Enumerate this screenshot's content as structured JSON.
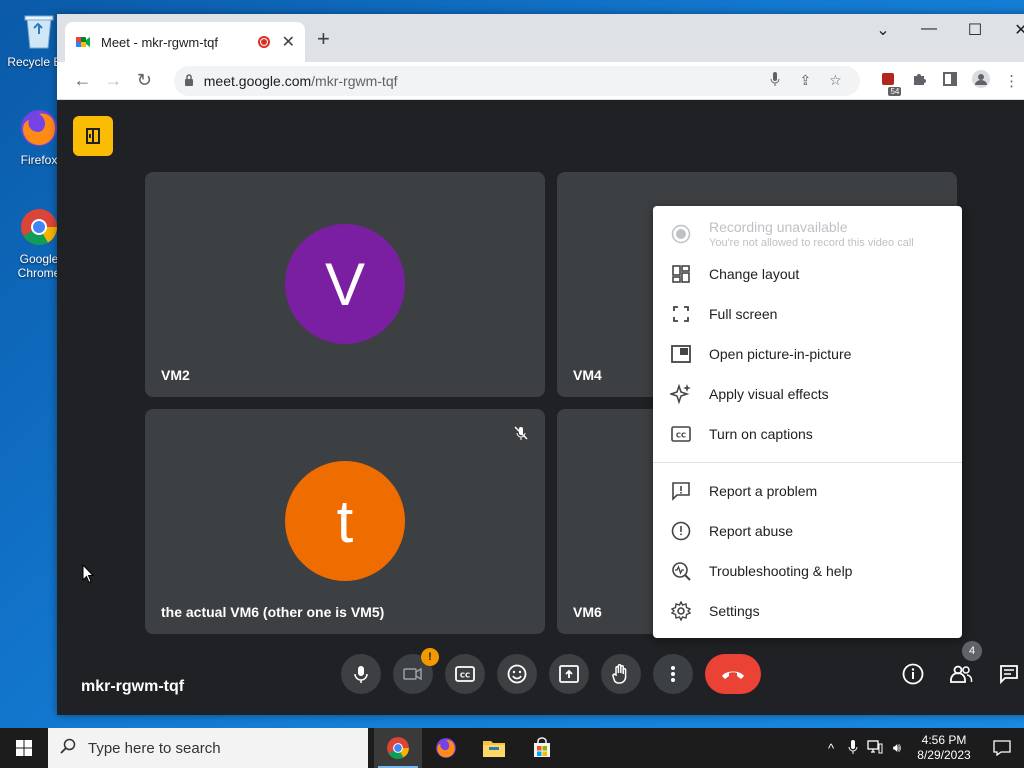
{
  "desktop": {
    "icons": [
      {
        "label": "Recycle Bin"
      },
      {
        "label": "Firefox"
      },
      {
        "label": "Google Chrome"
      }
    ]
  },
  "browser": {
    "tab_title": "Meet - mkr-rgwm-tqf",
    "new_tab_label": "+",
    "url_host": "meet.google.com",
    "url_path": "/mkr-rgwm-tqf",
    "extension_badge": "54"
  },
  "meet": {
    "meeting_code": "mkr-rgwm-tqf",
    "participant_count": "4",
    "tiles": [
      {
        "name": "VM2",
        "initial": "V",
        "avatar_color": "#7b1fa2"
      },
      {
        "name": "VM4",
        "initial": "",
        "avatar_color": ""
      },
      {
        "name": "the actual VM6 (other one is VM5)",
        "initial": "t",
        "avatar_color": "#ef6c00"
      },
      {
        "name": "VM6",
        "initial": "",
        "avatar_color": ""
      }
    ],
    "camera_warning": "!"
  },
  "menu": {
    "recording_title": "Recording unavailable",
    "recording_sub": "You're not allowed to record this video call",
    "items": [
      {
        "label": "Change layout"
      },
      {
        "label": "Full screen"
      },
      {
        "label": "Open picture-in-picture"
      },
      {
        "label": "Apply visual effects"
      },
      {
        "label": "Turn on captions"
      },
      {
        "label": "Report a problem"
      },
      {
        "label": "Report abuse"
      },
      {
        "label": "Troubleshooting & help"
      },
      {
        "label": "Settings"
      }
    ]
  },
  "taskbar": {
    "search_placeholder": "Type here to search",
    "time": "4:56 PM",
    "date": "8/29/2023"
  },
  "colors": {
    "end_call": "#ea4335",
    "host_badge": "#fbbc04",
    "warning": "#f29900"
  }
}
